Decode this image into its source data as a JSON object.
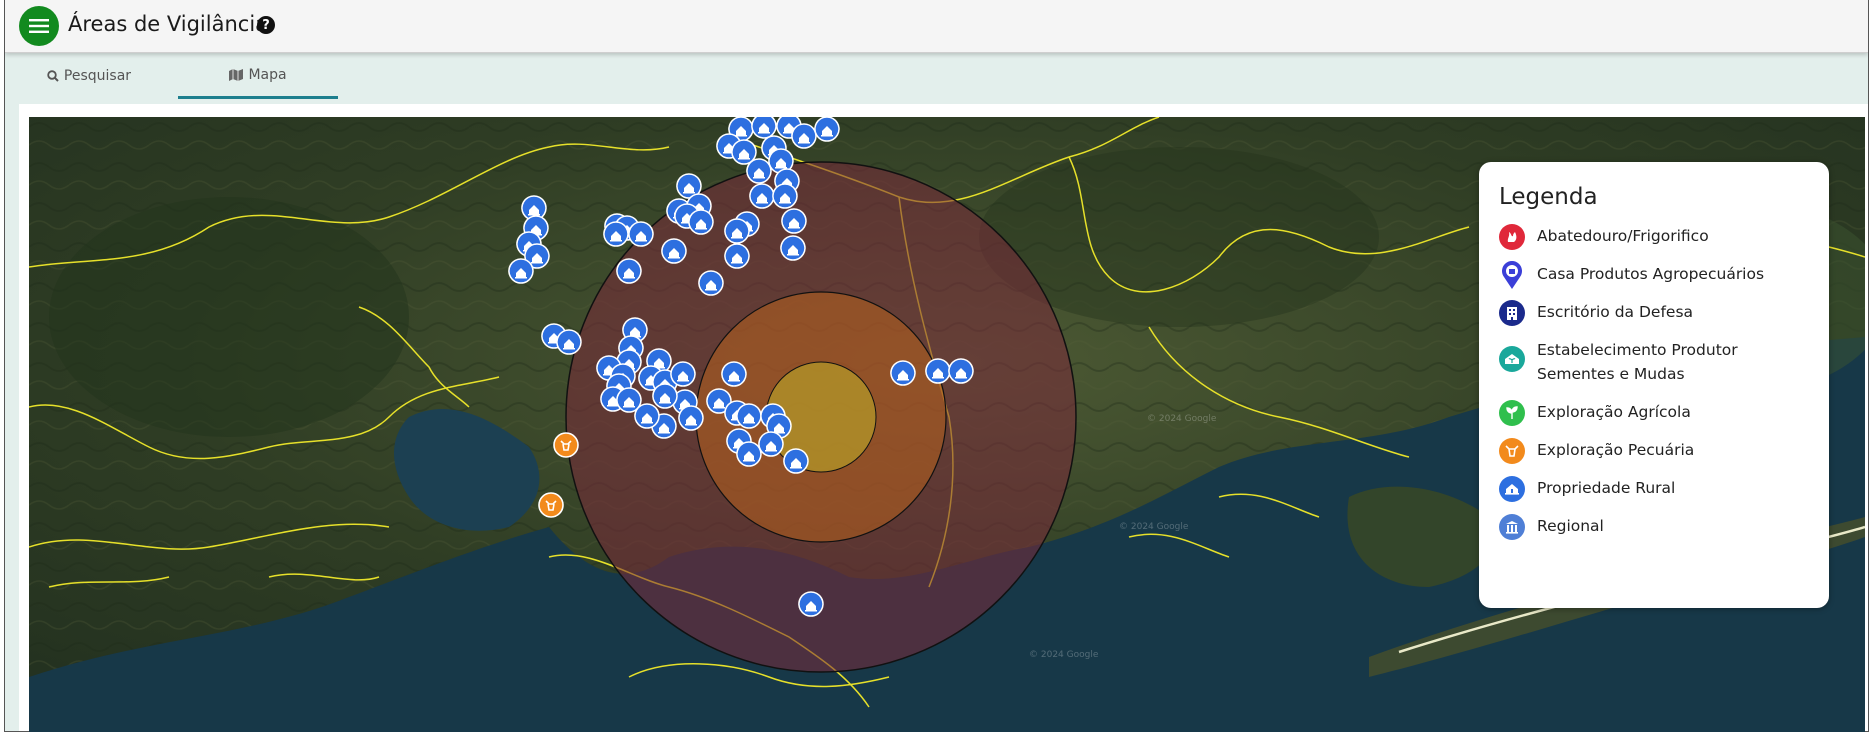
{
  "header": {
    "title": "Áreas de Vigilância",
    "menu_icon": "hamburger-menu-icon",
    "help_icon": "question-circle-icon",
    "accent": "#128a1f"
  },
  "tabs": [
    {
      "label": "Pesquisar",
      "icon": "search-icon",
      "active": false
    },
    {
      "label": "Mapa",
      "icon": "map-icon",
      "active": true
    }
  ],
  "legend": {
    "title": "Legenda",
    "items": [
      {
        "label": "Abatedouro/Frigorifico",
        "icon": "slaughterhouse-icon",
        "color": "#e0283a"
      },
      {
        "label": "Casa Produtos Agropecuários",
        "icon": "store-pin-icon",
        "color": "#3b3fd8"
      },
      {
        "label": "Escritório da Defesa",
        "icon": "office-building-icon",
        "color": "#1b2a8c"
      },
      {
        "label_line1": "Estabelecimento Produtor",
        "label_line2": "Sementes e Mudas",
        "icon": "seedling-house-icon",
        "color": "#1aa89b"
      },
      {
        "label": "Exploração Agrícola",
        "icon": "sprout-icon",
        "color": "#2fbf4d"
      },
      {
        "label": "Exploração Pecuária",
        "icon": "cow-icon",
        "color": "#f28a1c"
      },
      {
        "label": "Propriedade Rural",
        "icon": "farmhouse-icon",
        "color": "#2d6fe0"
      },
      {
        "label": "Regional",
        "icon": "regional-building-icon",
        "color": "#4f7fd6"
      }
    ]
  },
  "map": {
    "zones": [
      {
        "name": "outer-zone",
        "color": "#7a2a3a"
      },
      {
        "name": "middle-zone",
        "color": "#b8621e"
      },
      {
        "name": "inner-zone",
        "color": "#b8a228"
      }
    ],
    "watermark": "© 2024 Google"
  }
}
